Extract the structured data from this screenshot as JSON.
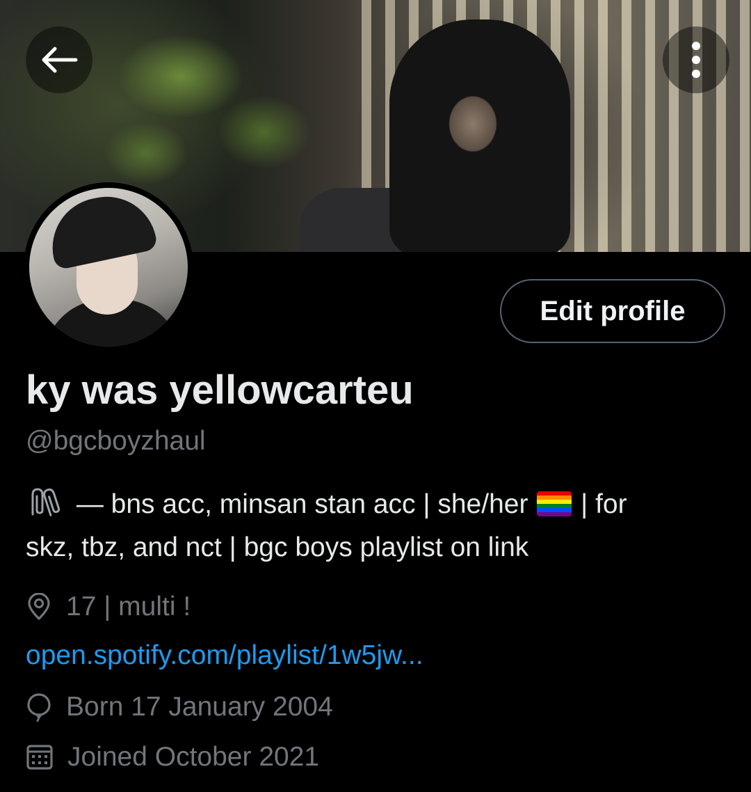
{
  "header": {
    "back_icon": "arrow-left-icon",
    "more_icon": "more-vertical-icon"
  },
  "profile": {
    "edit_label": "Edit profile",
    "display_name": "ky was yellowcarteu",
    "handle": "@bgcboyzhaul",
    "bio_line1_prefix": "— bns acc, minsan stan acc | she/her",
    "bio_line1_suffix": "| for",
    "bio_line2": "skz, tbz, and nct | bgc boys playlist on link",
    "location": "17 | multi !",
    "website": "open.spotify.com/playlist/1w5jw...",
    "birthday": "Born 17 January 2004",
    "joined": "Joined October 2021"
  },
  "colors": {
    "background": "#000000",
    "primary_text": "#e7e9ea",
    "secondary_text": "#71767b",
    "link": "#1d9bf0",
    "button_border": "#536471"
  }
}
